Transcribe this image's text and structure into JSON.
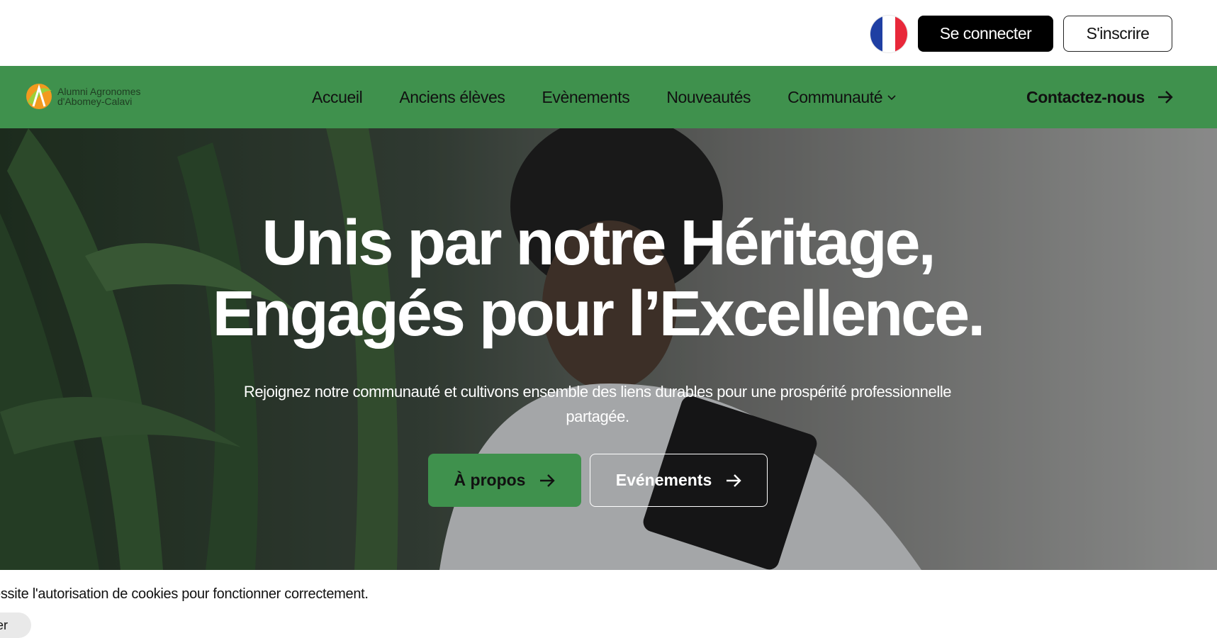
{
  "top_bar": {
    "language_flag": "france-flag-icon",
    "login_label": "Se connecter",
    "signup_label": "S'inscrire"
  },
  "brand": {
    "line1": "Alumni Agronomes",
    "line2": "d'Abomey-Calavi"
  },
  "nav": {
    "items": [
      {
        "label": "Accueil"
      },
      {
        "label": "Anciens élèves"
      },
      {
        "label": "Evènements"
      },
      {
        "label": "Nouveautés"
      },
      {
        "label": "Communauté",
        "icon": "chevron-down-icon"
      }
    ],
    "contact_label": "Contactez-nous"
  },
  "hero": {
    "title_line1": "Unis par notre Héritage,",
    "title_line2": "Engagés pour l’Excellence.",
    "subtitle": "Rejoignez notre communauté et cultivons ensemble des liens durables pour une prospérité professionnelle partagée.",
    "primary_button": "À propos",
    "secondary_button": "Evénements"
  },
  "cookie_banner": {
    "text": "essite l'autorisation de cookies pour fonctionner correctement.",
    "button_label": "er"
  },
  "colors": {
    "brand_green": "#3f914d",
    "black": "#000000",
    "white": "#ffffff"
  }
}
